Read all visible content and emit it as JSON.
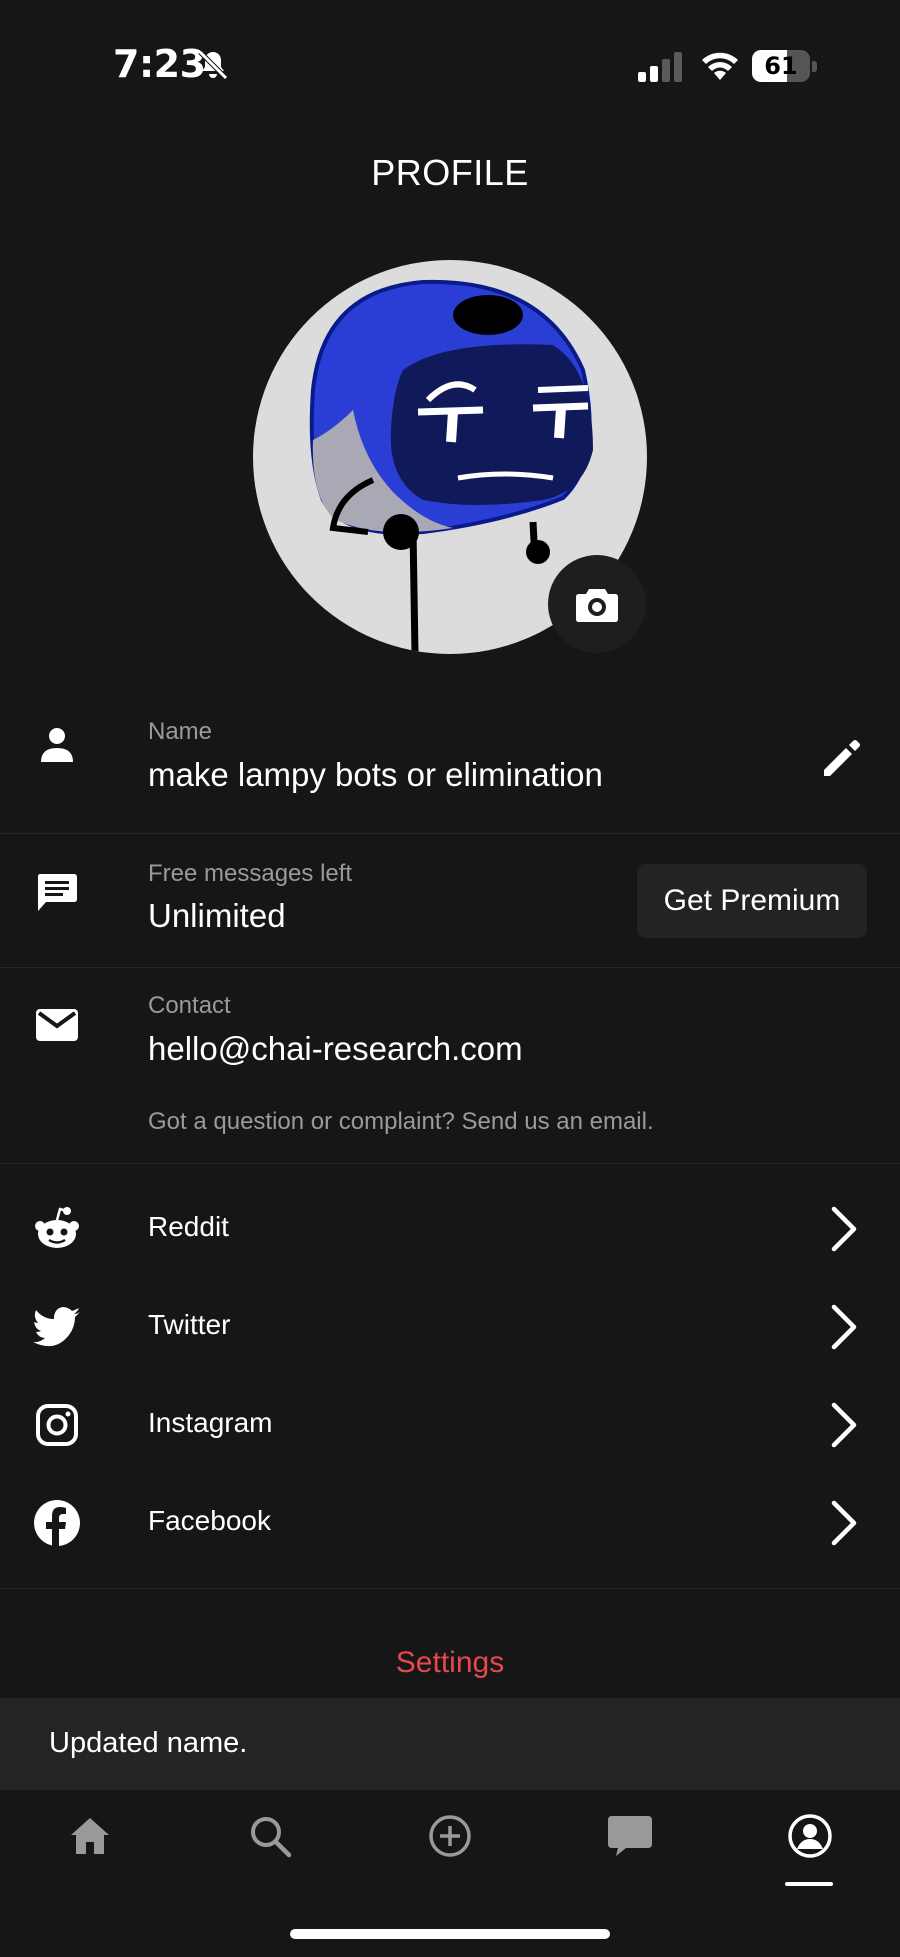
{
  "status_bar": {
    "time": "7:23",
    "battery": "61",
    "battery_level": 0.61
  },
  "header": {
    "title": "PROFILE"
  },
  "profile": {
    "name_label": "Name",
    "name_value": "make lampy bots or elimination",
    "messages_label": "Free messages left",
    "messages_value": "Unlimited",
    "premium_button": "Get Premium",
    "contact_label": "Contact",
    "contact_value": "hello@chai-research.com",
    "contact_hint": "Got a question or complaint? Send us an email."
  },
  "social": [
    {
      "label": "Reddit",
      "icon": "reddit-icon"
    },
    {
      "label": "Twitter",
      "icon": "twitter-icon"
    },
    {
      "label": "Instagram",
      "icon": "instagram-icon"
    },
    {
      "label": "Facebook",
      "icon": "facebook-icon"
    }
  ],
  "settings_link": "Settings",
  "toast": {
    "message": "Updated name."
  },
  "tabbar": {
    "tabs": [
      {
        "icon": "home-icon"
      },
      {
        "icon": "search-icon"
      },
      {
        "icon": "add-circle-icon"
      },
      {
        "icon": "chat-icon"
      },
      {
        "icon": "profile-icon",
        "active": true
      }
    ]
  },
  "colors": {
    "background": "#161616",
    "accent_red": "#e5484d",
    "muted_text": "#9a9a9a"
  }
}
